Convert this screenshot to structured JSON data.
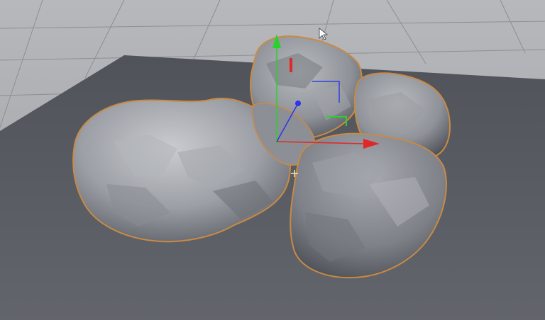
{
  "viewport": {
    "background_grid_color": "#a9abaf",
    "grid_line_color": "#8f9296",
    "floor_color": "#55585d",
    "rock_color": "#8d9096",
    "rock_highlight_color": "#c3c5ca",
    "rock_shadow_color": "#3d3f44",
    "selection_outline_color": "#c98a45"
  },
  "gizmo": {
    "x_axis_color": "#e02828",
    "y_axis_color": "#2bd12b",
    "z_axis_color": "#2d35e8",
    "plane_marker_color": "#3140e0"
  },
  "cursor": {
    "pointer_icon": "arrow-cursor-icon",
    "crosshair_icon": "crosshair-cursor-icon"
  }
}
